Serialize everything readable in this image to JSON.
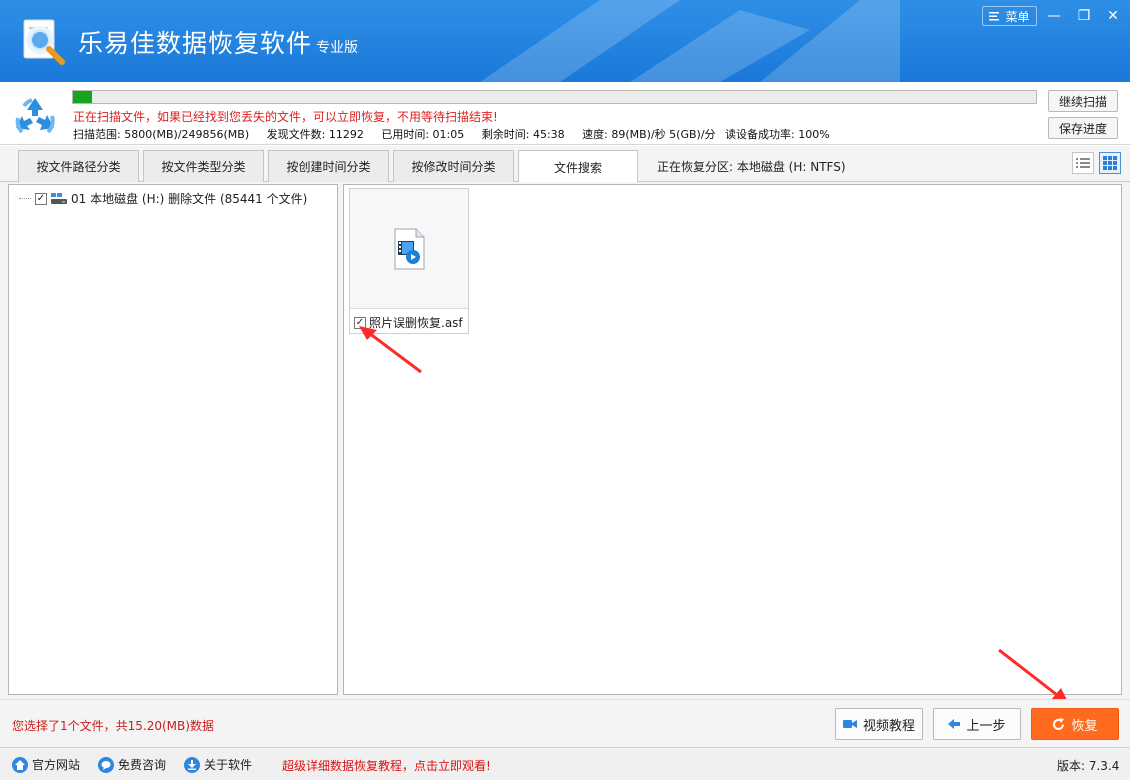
{
  "app": {
    "title": "乐易佳数据恢复软件",
    "edition": "专业版",
    "menu_label": "菜单",
    "minimize_glyph": "—",
    "restore_glyph": "❐",
    "close_glyph": "✕"
  },
  "scan": {
    "progress": 0.02,
    "message": "正在扫描文件，如果已经找到您丢失的文件，可以立即恢复，不用等待扫描结束!",
    "stats": {
      "range": "扫描范围: 5800(MB)/249856(MB)",
      "found": "发现文件数: 11292",
      "elapsed": "已用时间: 01:05",
      "remaining": "剩余时间: 45:38",
      "speed": "速度: 89(MB)/秒  5(GB)/分",
      "success_rate": "读设备成功率: 100%"
    },
    "continue_label": "继续扫描",
    "save_label": "保存进度"
  },
  "tabs": [
    {
      "label": "按文件路径分类",
      "active": false
    },
    {
      "label": "按文件类型分类",
      "active": false
    },
    {
      "label": "按创建时间分类",
      "active": false
    },
    {
      "label": "按修改时间分类",
      "active": false
    },
    {
      "label": "文件搜索",
      "active": true
    }
  ],
  "partition_label": "正在恢复分区: 本地磁盘 (H: NTFS)",
  "view_modes": {
    "active": "grid-view-icon"
  },
  "tree": {
    "root": {
      "label": "01 本地磁盘 (H:) 删除文件  (85441 个文件)",
      "checked": true
    }
  },
  "files": [
    {
      "name": "照片误删恢复.asf",
      "checked": true,
      "icon": "video-file-icon"
    }
  ],
  "selection_info": "您选择了1个文件，共15.20(MB)数据",
  "actions": {
    "video_tutorial": "视频教程",
    "prev_step": "上一步",
    "recover": "恢复"
  },
  "status": {
    "official_site": "官方网站",
    "free_consult": "免费咨询",
    "about": "关于软件",
    "promo": "超级详细数据恢复教程，点击立即观看!",
    "version": "版本: 7.3.4"
  },
  "colors": {
    "title_bar": "#1a78d9",
    "progress_fill": "#16a51f",
    "alert_text": "#d22222",
    "recover_button": "#ff6a1f",
    "annotation_arrow": "#ff2a2a"
  }
}
